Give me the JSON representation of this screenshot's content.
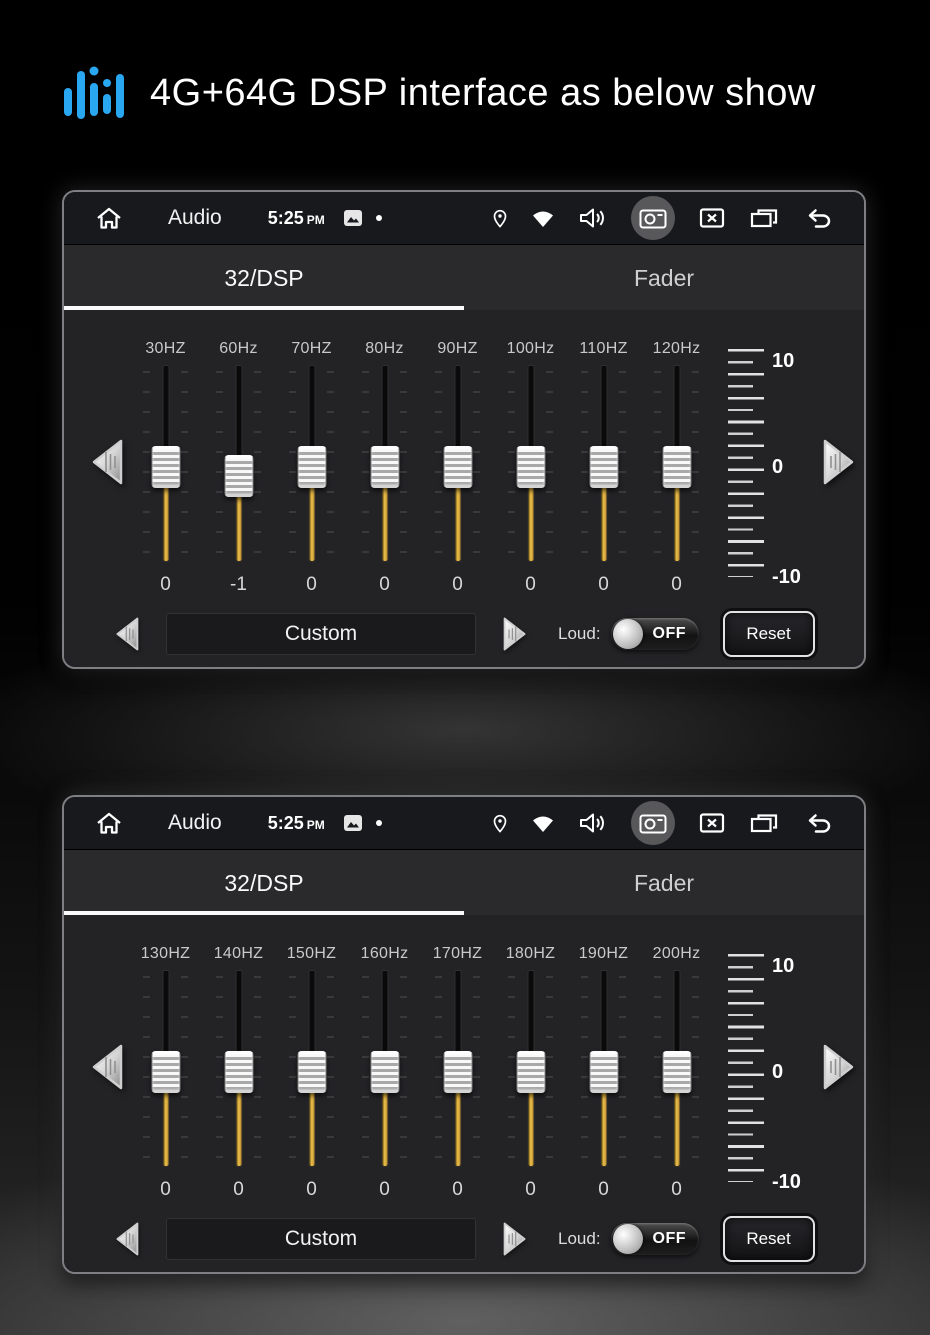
{
  "header": {
    "title": "4G+64G DSP interface as below show",
    "icon": "equalizer-bars-icon",
    "accent_color": "#2aa7f1"
  },
  "panels": [
    {
      "statusbar": {
        "app_label": "Audio",
        "time": "5:25",
        "meridiem": "PM",
        "left_icons": [
          "home-icon",
          "gallery-icon",
          "notification-dot"
        ],
        "right_icons": [
          "location-icon",
          "wifi-icon",
          "volume-icon",
          "screenshot-camera-icon",
          "close-icon",
          "recent-apps-icon",
          "back-icon"
        ]
      },
      "tabs": {
        "eq_tab": "32/DSP",
        "fader_tab": "Fader"
      },
      "eq": {
        "freqs": [
          "30HZ",
          "60Hz",
          "70HZ",
          "80Hz",
          "90HZ",
          "100Hz",
          "110HZ",
          "120Hz"
        ],
        "values": [
          "0",
          "-1",
          "0",
          "0",
          "0",
          "0",
          "0",
          "0"
        ],
        "scale_labels": [
          "10",
          "0",
          "-10"
        ],
        "slider_fill_color": "#d9a62f"
      },
      "controls": {
        "preset": "Custom",
        "loud_label": "Loud:",
        "loud_state": "OFF",
        "reset_label": "Reset"
      }
    },
    {
      "statusbar": {
        "app_label": "Audio",
        "time": "5:25",
        "meridiem": "PM",
        "left_icons": [
          "home-icon",
          "gallery-icon",
          "notification-dot"
        ],
        "right_icons": [
          "location-icon",
          "wifi-icon",
          "volume-icon",
          "screenshot-camera-icon",
          "close-icon",
          "recent-apps-icon",
          "back-icon"
        ]
      },
      "tabs": {
        "eq_tab": "32/DSP",
        "fader_tab": "Fader"
      },
      "eq": {
        "freqs": [
          "130HZ",
          "140HZ",
          "150HZ",
          "160Hz",
          "170HZ",
          "180HZ",
          "190HZ",
          "200Hz"
        ],
        "values": [
          "0",
          "0",
          "0",
          "0",
          "0",
          "0",
          "0",
          "0"
        ],
        "scale_labels": [
          "10",
          "0",
          "-10"
        ],
        "slider_fill_color": "#d9a62f"
      },
      "controls": {
        "preset": "Custom",
        "loud_label": "Loud:",
        "loud_state": "OFF",
        "reset_label": "Reset"
      }
    }
  ]
}
